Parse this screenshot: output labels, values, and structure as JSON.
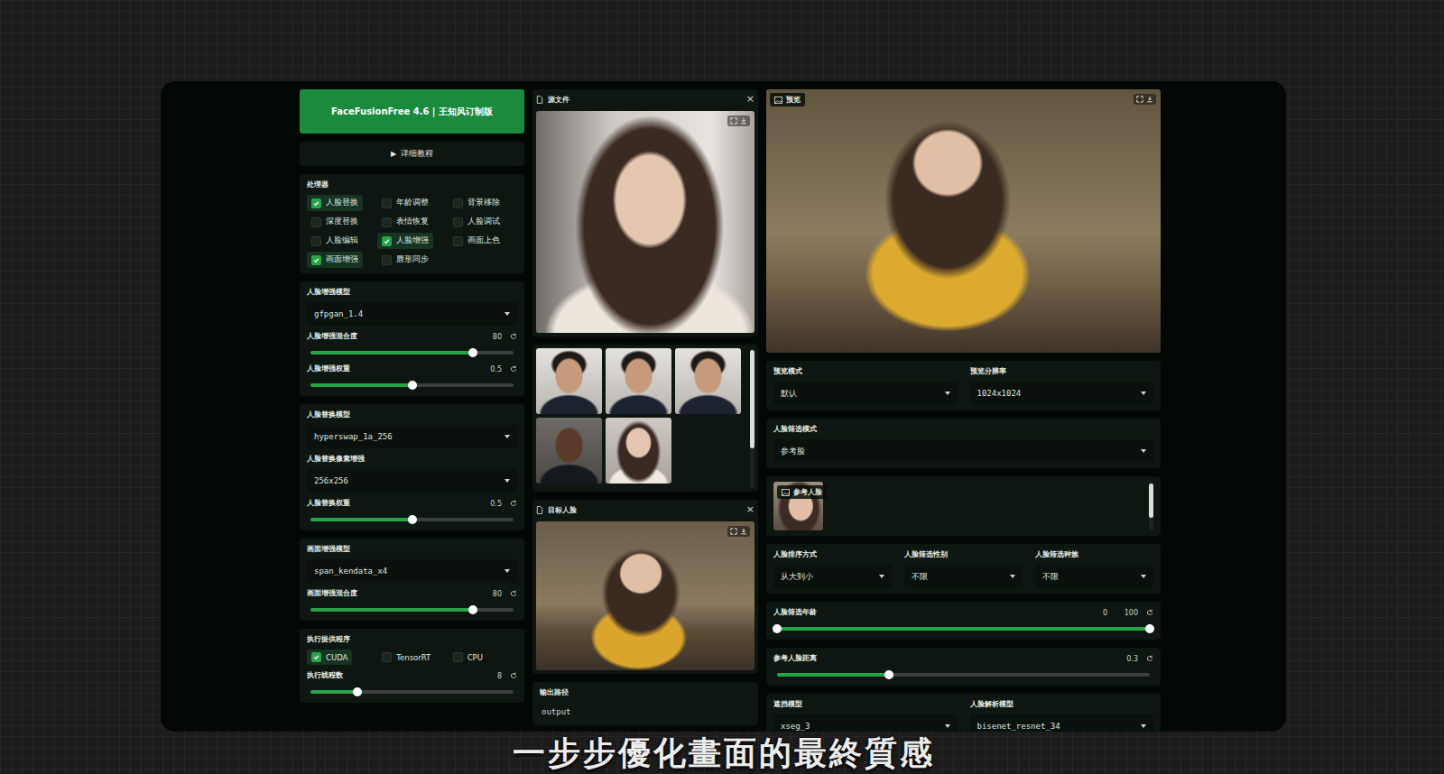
{
  "subtitle": "一步步優化畫面的最終質感",
  "app": {
    "title": "FaceFusionFree 4.6 | 王知风订制版"
  },
  "tutorial": {
    "icon": "▶",
    "label": "详细教程",
    "expanded": false
  },
  "left_groups": [
    {
      "items": [
        {
          "kind": "checkgroup",
          "label": "处理器",
          "options": [
            {
              "label": "人脸替换",
              "checked": true
            },
            {
              "label": "年龄调整",
              "checked": false
            },
            {
              "label": "背景移除",
              "checked": false
            },
            {
              "label": "深度替换",
              "checked": false
            },
            {
              "label": "表情恢复",
              "checked": false
            },
            {
              "label": "人脸调试",
              "checked": false
            },
            {
              "label": "人脸编辑",
              "checked": false
            },
            {
              "label": "人脸增强",
              "checked": true
            },
            {
              "label": "画面上色",
              "checked": false
            },
            {
              "label": "画面增强",
              "checked": true
            },
            {
              "label": "唇形同步",
              "checked": false
            }
          ]
        }
      ]
    },
    {
      "items": [
        {
          "kind": "dropdown",
          "label": "人脸增强模型",
          "value": "gfpgan_1.4"
        },
        {
          "kind": "slider",
          "label": "人脸增强混合度",
          "value": "80",
          "level": 0.8
        },
        {
          "kind": "slider",
          "label": "人脸增强权重",
          "value": "0.5",
          "level": 0.5
        }
      ]
    },
    {
      "items": [
        {
          "kind": "dropdown",
          "label": "人脸替换模型",
          "value": "hyperswap_1a_256"
        },
        {
          "kind": "dropdown",
          "label": "人脸替换像素增强",
          "value": "256x256"
        },
        {
          "kind": "slider",
          "label": "人脸替换权重",
          "value": "0.5",
          "level": 0.5
        }
      ]
    },
    {
      "items": [
        {
          "kind": "dropdown",
          "label": "画面增强模型",
          "value": "span_kendata_x4"
        },
        {
          "kind": "slider",
          "label": "画面增强混合度",
          "value": "80",
          "level": 0.8
        }
      ]
    },
    {
      "items": [
        {
          "kind": "checkgroup",
          "label": "执行提供程序",
          "options": [
            {
              "label": "CUDA",
              "checked": true
            },
            {
              "label": "TensorRT",
              "checked": false
            },
            {
              "label": "CPU",
              "checked": false
            }
          ]
        },
        {
          "kind": "slider",
          "label": "执行线程数",
          "value": "8",
          "level": 0.23
        }
      ]
    }
  ],
  "source": {
    "title": "源文件",
    "close": "×"
  },
  "target": {
    "title": "目标人脸",
    "close": "×"
  },
  "output": {
    "label": "输出路径",
    "value": "output"
  },
  "preview": {
    "title": "预览"
  },
  "right_groups": [
    {
      "items": [
        {
          "kind": "dropdown",
          "label": "预览模式",
          "value": "默认"
        },
        {
          "kind": "dropdown",
          "label": "预览分辨率",
          "value": "1024x1024"
        }
      ]
    },
    {
      "items": [
        {
          "kind": "dropdown",
          "label": "人脸筛选模式",
          "value": "参考脸"
        }
      ]
    },
    {
      "items": [
        {
          "kind": "gallery",
          "label": "参考人脸"
        }
      ]
    },
    {
      "items": [
        {
          "kind": "dropdown",
          "label": "人脸排序方式",
          "value": "从大到小"
        },
        {
          "kind": "dropdown",
          "label": "人脸筛选性别",
          "value": "不限"
        },
        {
          "kind": "dropdown",
          "label": "人脸筛选种族",
          "value": "不限"
        }
      ]
    },
    {
      "items": [
        {
          "kind": "range",
          "label": "人脸筛选年龄",
          "low": "0",
          "high": "100",
          "level": 1
        }
      ]
    },
    {
      "items": [
        {
          "kind": "slider",
          "label": "参考人脸距离",
          "value": "0.3",
          "level": 0.3
        }
      ]
    },
    {
      "items": [
        {
          "kind": "dropdown",
          "label": "遮挡模型",
          "value": "xseg_3"
        },
        {
          "kind": "dropdown",
          "label": "人脸解析模型",
          "value": "bisenet_resnet_34"
        }
      ]
    }
  ]
}
